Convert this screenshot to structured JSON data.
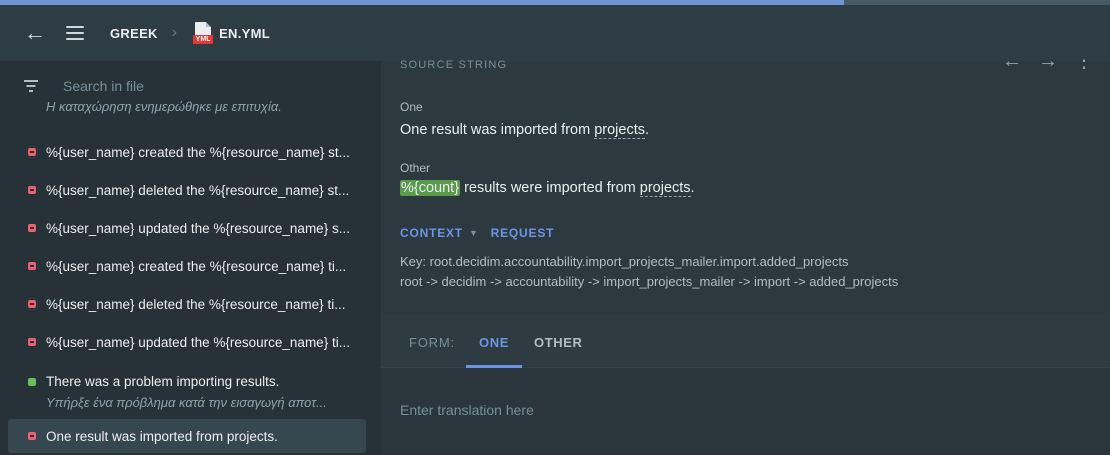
{
  "progress": {
    "fraction": 0.76,
    "color": "#6e94d3"
  },
  "header": {
    "back_icon": "arrow-left-icon",
    "menu_icon": "hamburger-icon",
    "breadcrumb_language": "GREEK",
    "file_icon": "yml-file-icon",
    "file_icon_tag": "YML",
    "file_name": "EN.YML"
  },
  "sidebar": {
    "search_placeholder": "Search in file",
    "first_item_translation": "Η καταχώρηση ενημερώθηκε με επιτυχία.",
    "items": [
      {
        "text": "%{user_name} created the %{resource_name} st...",
        "status": "untranslated"
      },
      {
        "text": "%{user_name} deleted the %{resource_name} st...",
        "status": "untranslated"
      },
      {
        "text": "%{user_name} updated the %{resource_name} s...",
        "status": "untranslated"
      },
      {
        "text": "%{user_name} created the %{resource_name} ti...",
        "status": "untranslated"
      },
      {
        "text": "%{user_name} deleted the %{resource_name} ti...",
        "status": "untranslated"
      },
      {
        "text": "%{user_name} updated the %{resource_name} ti...",
        "status": "untranslated"
      },
      {
        "text": "There was a problem importing results.",
        "translation": "Υπήρξε ένα πρόβλημα κατά την εισαγωγή αποτ...",
        "status": "translated"
      },
      {
        "text": "One result was imported from projects.",
        "status": "untranslated",
        "selected": true
      }
    ],
    "status_colors": {
      "untranslated": "#f06070",
      "translated": "#6dbd5a"
    }
  },
  "source": {
    "title": "SOURCE STRING",
    "one_label": "One",
    "one_text_before": "One result was imported from ",
    "one_text_term": "projects",
    "one_text_after": ".",
    "other_label": "Other",
    "other_placeholder": "%{count}",
    "other_text_before": " results were imported from ",
    "other_text_term": "projects",
    "other_text_after": "."
  },
  "context": {
    "context_label": "CONTEXT",
    "request_label": "REQUEST",
    "key_line": "Key: root.decidim.accountability.import_projects_mailer.import.added_projects",
    "path_line": "root -> decidim -> accountability -> import_projects_mailer -> import -> added_projects"
  },
  "form": {
    "label": "FORM:",
    "tab_one": "ONE",
    "tab_other": "OTHER",
    "translation_placeholder": "Enter translation here"
  },
  "colors": {
    "accent": "#6e94e8",
    "placeholder_highlight": "#5a9a4a"
  }
}
